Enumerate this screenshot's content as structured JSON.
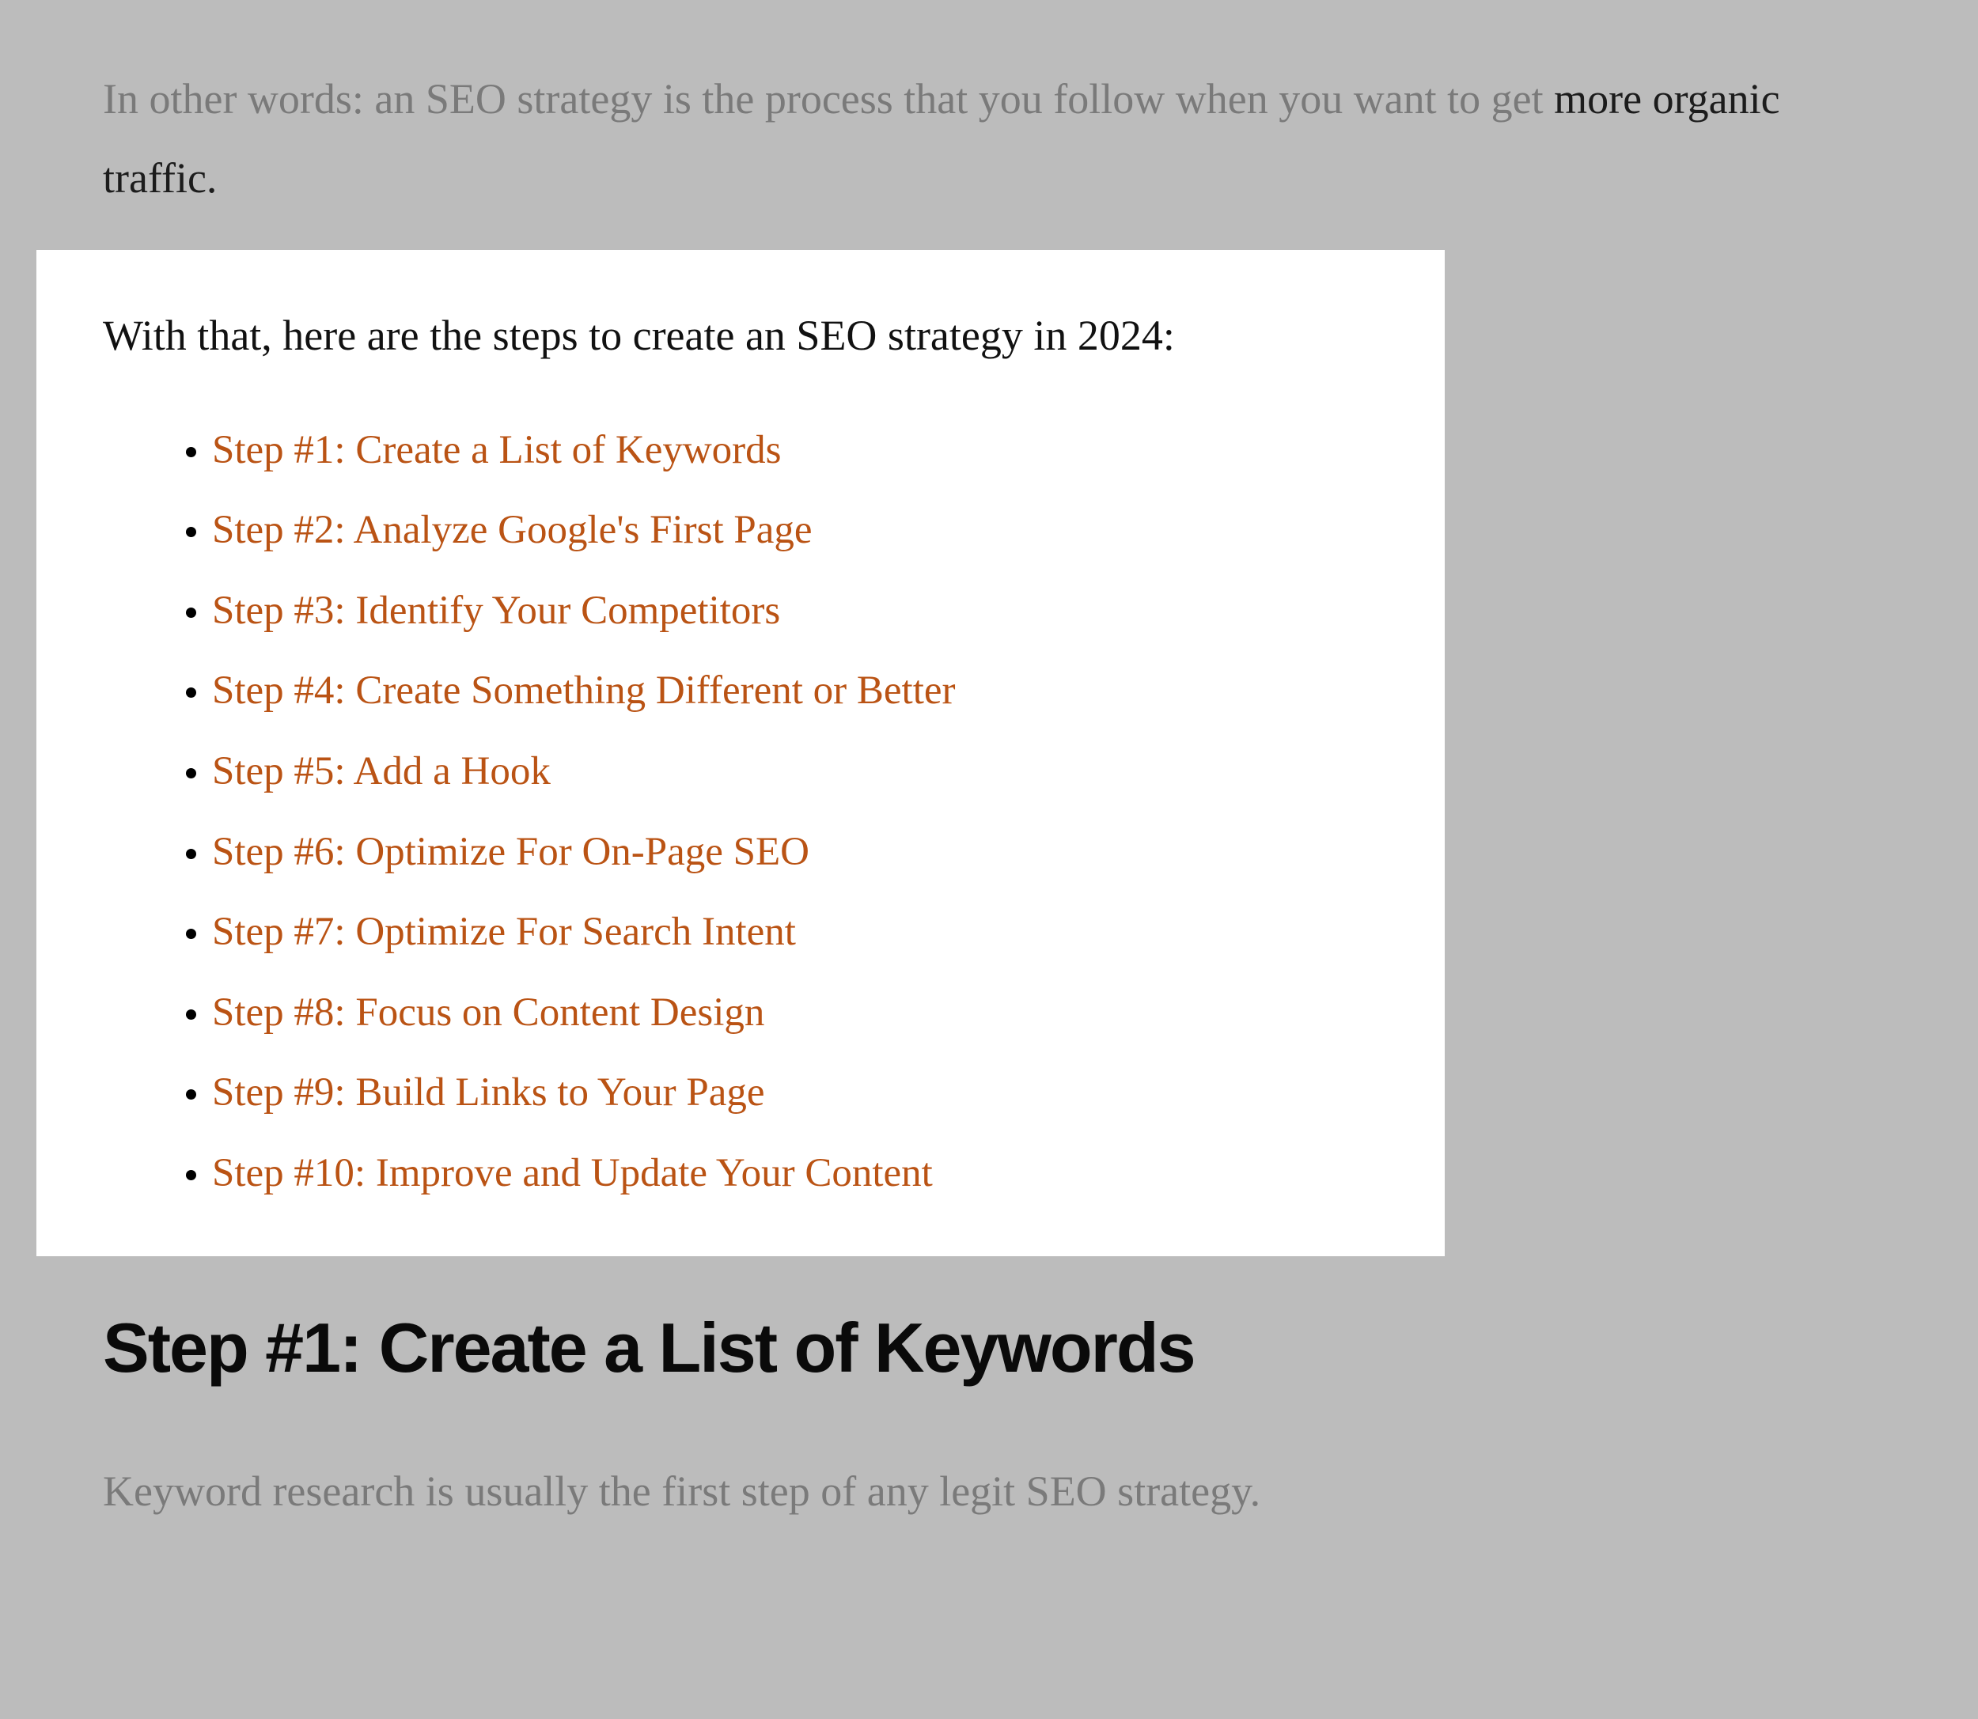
{
  "intro": {
    "pre": "In other words: an SEO strategy is the process that you follow when you want to get ",
    "emph": "more organic traffic."
  },
  "lead": "With that, here are the steps to create an SEO strategy in 2024:",
  "steps": [
    "Step #1: Create a List of Keywords",
    "Step #2: Analyze Google's First Page",
    "Step #3: Identify Your Competitors",
    "Step #4: Create Something Different or Better",
    "Step #5: Add a Hook",
    "Step #6: Optimize For On-Page SEO",
    "Step #7: Optimize For Search Intent",
    "Step #8: Focus on Content Design",
    "Step #9: Build Links to Your Page",
    "Step #10: Improve and Update Your Content"
  ],
  "section_heading": "Step #1: Create a List of Keywords",
  "section_para": "Keyword research is usually the first step of any legit SEO strategy."
}
